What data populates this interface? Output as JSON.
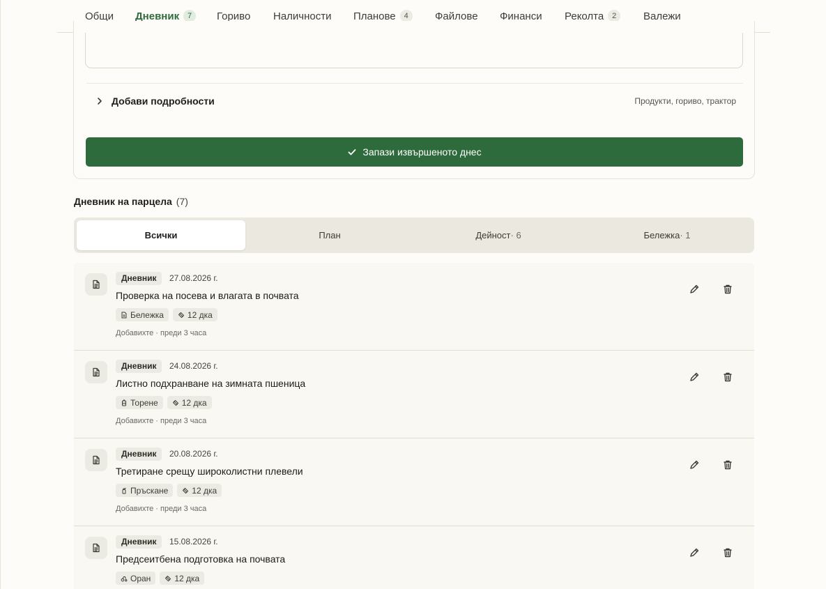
{
  "tabs": [
    {
      "label": "Общи",
      "count": null
    },
    {
      "label": "Дневник",
      "count": "7"
    },
    {
      "label": "Гориво",
      "count": null
    },
    {
      "label": "Наличности",
      "count": null
    },
    {
      "label": "Планове",
      "count": "4"
    },
    {
      "label": "Файлове",
      "count": null
    },
    {
      "label": "Финанси",
      "count": null
    },
    {
      "label": "Реколта",
      "count": "2"
    },
    {
      "label": "Валежи",
      "count": null
    }
  ],
  "active_tab": "Дневник",
  "form": {
    "details_label": "Добави подробности",
    "details_hint": "Продукти, гориво, трактор",
    "save_label": "Запази извършеното днес"
  },
  "journal": {
    "title": "Дневник на парцела",
    "count": "(7)"
  },
  "filters": [
    {
      "label": "Всички",
      "count": ""
    },
    {
      "label": "План",
      "count": ""
    },
    {
      "label": "Дейност",
      "count": " · 6"
    },
    {
      "label": "Бележка",
      "count": " · 1"
    }
  ],
  "active_filter": "Всички",
  "entries": [
    {
      "type": "Дневник",
      "date": "27.08.2026 г.",
      "title": "Проверка на посева и влагата в почвата",
      "chips": [
        {
          "icon": "note-icon",
          "label": "Бележка"
        },
        {
          "icon": "area-icon",
          "label": "12 дка"
        }
      ],
      "meta": "Добавихте · преди 3 часа"
    },
    {
      "type": "Дневник",
      "date": "24.08.2026 г.",
      "title": "Листно подхранване на зимната пшеница",
      "chips": [
        {
          "icon": "fertilizer-icon",
          "label": "Торене"
        },
        {
          "icon": "area-icon",
          "label": "12 дка"
        }
      ],
      "meta": "Добавихте · преди 3 часа"
    },
    {
      "type": "Дневник",
      "date": "20.08.2026 г.",
      "title": "Третиране срещу широколистни плевели",
      "chips": [
        {
          "icon": "spray-icon",
          "label": "Пръскане"
        },
        {
          "icon": "area-icon",
          "label": "12 дка"
        }
      ],
      "meta": "Добавихте · преди 3 часа"
    },
    {
      "type": "Дневник",
      "date": "15.08.2026 г.",
      "title": "Предсеитбена подготовка на почвата",
      "chips": [
        {
          "icon": "tractor-icon",
          "label": "Оран"
        },
        {
          "icon": "area-icon",
          "label": "12 дка"
        }
      ],
      "meta": ""
    }
  ],
  "colors": {
    "accent": "#2e6b3c",
    "background": "#fdfcf8",
    "chip": "#ecebe3"
  }
}
